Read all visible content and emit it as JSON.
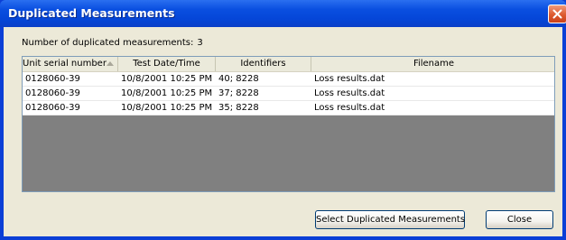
{
  "window": {
    "title": "Duplicated Measurements"
  },
  "summary": {
    "label": "Number of duplicated measurements:",
    "count": "3"
  },
  "table": {
    "columns": [
      "Unit serial number",
      "Test Date/Time",
      "Identifiers",
      "Filename"
    ],
    "rows": [
      [
        "0128060-39",
        "10/8/2001 10:25 PM",
        "40; 8228",
        "Loss results.dat"
      ],
      [
        "0128060-39",
        "10/8/2001 10:25 PM",
        "37; 8228",
        "Loss results.dat"
      ],
      [
        "0128060-39",
        "10/8/2001 10:25 PM",
        "35; 8228",
        "Loss results.dat"
      ]
    ]
  },
  "buttons": {
    "select_duplicated": "Select Duplicated Measurements",
    "close": "Close"
  },
  "icons": {
    "close": "close-x-icon",
    "sort": "sort-ascending-icon"
  },
  "colors": {
    "titlebar": "#0a4fe0",
    "dialog_bg": "#ece9d8",
    "grid_empty": "#808080",
    "close_button": "#dd5a2f"
  }
}
